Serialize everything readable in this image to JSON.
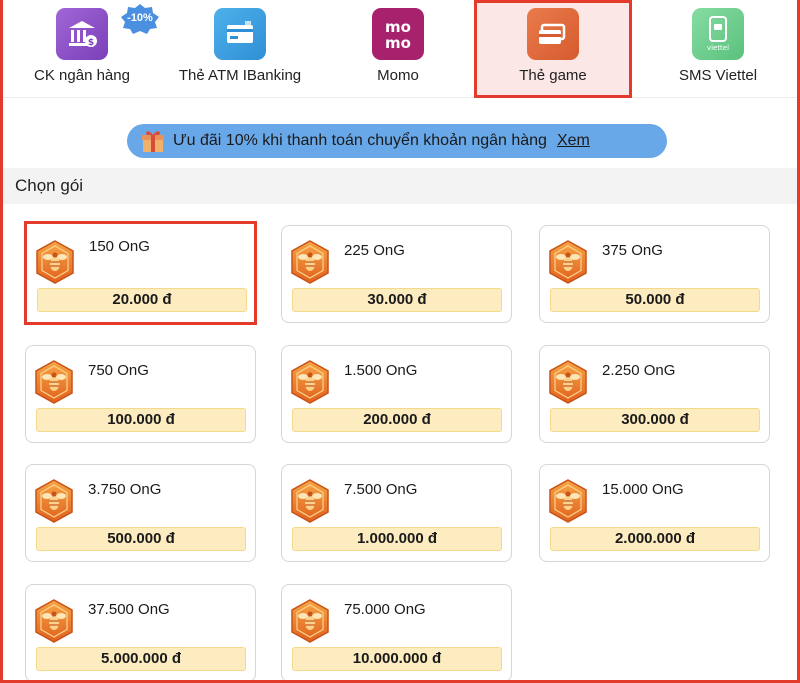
{
  "methods": [
    {
      "label": "CK ngân hàng",
      "badge": "-10%"
    },
    {
      "label": "Thẻ ATM IBanking"
    },
    {
      "label": "Momo",
      "logo": "mo mo"
    },
    {
      "label": "Thẻ game"
    },
    {
      "label": "SMS Viettel",
      "logo": "viettel"
    }
  ],
  "promo": {
    "text": "Ưu đãi 10% khi thanh toán chuyển khoản ngân hàng",
    "link": "Xem"
  },
  "section_title": "Chọn gói",
  "packages": [
    {
      "amount": "150 OnG",
      "price": "20.000 đ"
    },
    {
      "amount": "225 OnG",
      "price": "30.000 đ"
    },
    {
      "amount": "375 OnG",
      "price": "50.000 đ"
    },
    {
      "amount": "750 OnG",
      "price": "100.000 đ"
    },
    {
      "amount": "1.500 OnG",
      "price": "200.000 đ"
    },
    {
      "amount": "2.250 OnG",
      "price": "300.000 đ"
    },
    {
      "amount": "3.750 OnG",
      "price": "500.000 đ"
    },
    {
      "amount": "7.500 OnG",
      "price": "1.000.000 đ"
    },
    {
      "amount": "15.000 OnG",
      "price": "2.000.000 đ"
    },
    {
      "amount": "37.500 OnG",
      "price": "5.000.000 đ"
    },
    {
      "amount": "75.000 OnG",
      "price": "10.000.000 đ"
    }
  ],
  "colors": {
    "highlight": "#e23b2c",
    "selected_bg": "#fbe7e5",
    "promo_bg": "#69a8e8",
    "price_bg": "#fdecc0",
    "bank_icon": "#8f52c4",
    "atm_icon": "#3a9ee0",
    "momo_icon": "#a8216d",
    "game_icon": "#e06a3b",
    "viettel_icon": "#6fce8d",
    "hex_icon": "#f0862a"
  },
  "icons": [
    "bank-icon",
    "atm-card-icon",
    "momo-icon",
    "game-card-icon",
    "sms-phone-icon",
    "gift-icon",
    "bee-hex-icon"
  ]
}
